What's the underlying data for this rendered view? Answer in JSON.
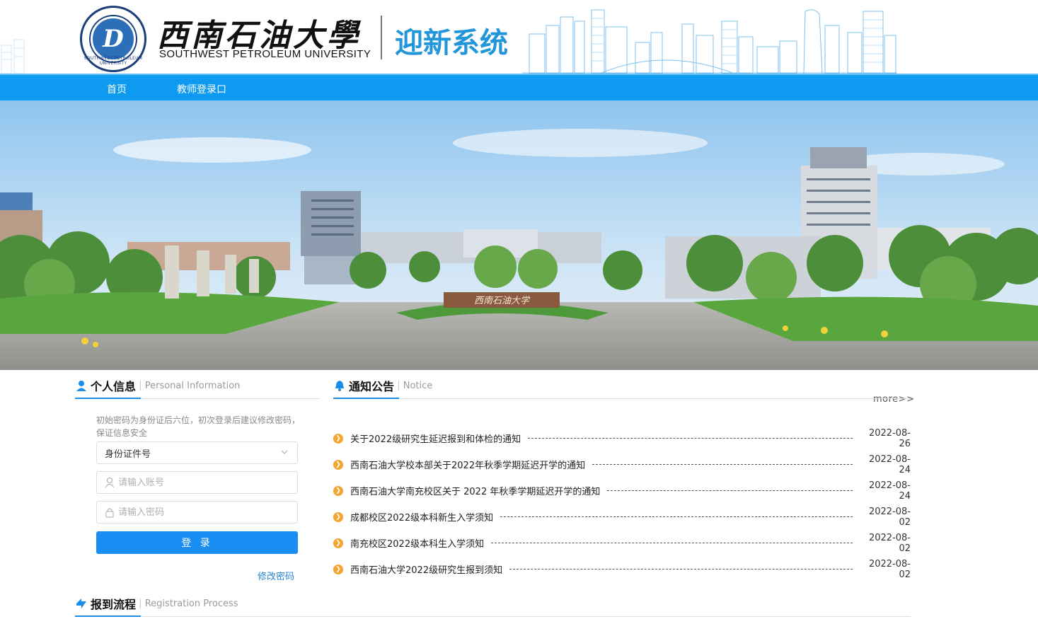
{
  "header": {
    "university_cn": "西南石油大學",
    "university_en": "SOUTHWEST PETROLEUM UNIVERSITY",
    "system_title": "迎新系统",
    "seal_text": "SOUTHWEST PETROLEUM UNIVERSITY"
  },
  "nav": {
    "items": [
      {
        "label": "首页"
      },
      {
        "label": "教师登录口"
      }
    ]
  },
  "banner": {
    "gate_text": "西南石油大学"
  },
  "personal": {
    "title_cn": "个人信息",
    "title_en": "Personal Information",
    "tip": "初始密码为身份证后六位，初次登录后建议修改密码，保证信息安全",
    "id_type": "身份证件号",
    "account_placeholder": "请输入账号",
    "password_placeholder": "请输入密码",
    "login_label": "登 录",
    "change_password": "修改密码"
  },
  "notice": {
    "title_cn": "通知公告",
    "title_en": "Notice",
    "more": "more>>",
    "items": [
      {
        "title": "关于2022级研究生延迟报到和体检的通知",
        "date": "2022-08-26"
      },
      {
        "title": "西南石油大学校本部关于2022年秋季学期延迟开学的通知",
        "date": "2022-08-24"
      },
      {
        "title": "西南石油大学南充校区关于 2022 年秋季学期延迟开学的通知",
        "date": "2022-08-24"
      },
      {
        "title": "成都校区2022级本科新生入学须知",
        "date": "2022-08-02"
      },
      {
        "title": "南充校区2022级本科生入学须知",
        "date": "2022-08-02"
      },
      {
        "title": "西南石油大学2022级研究生报到须知",
        "date": "2022-08-02"
      }
    ]
  },
  "process": {
    "title_cn": "报到流程",
    "title_en": "Registration Process"
  },
  "colors": {
    "primary": "#0e9af0",
    "accent": "#1a8ef2",
    "bullet": "#f2a531"
  }
}
